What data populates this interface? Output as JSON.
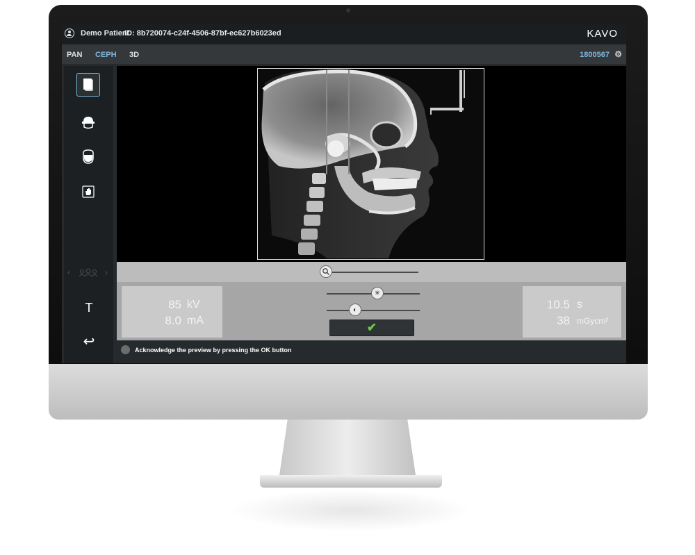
{
  "header": {
    "patient_name": "Demo Patient",
    "patient_id": "ID: 8b720074-c24f-4506-87bf-ec627b6023ed",
    "brand": "KAVO"
  },
  "modes": {
    "tabs": [
      "PAN",
      "CEPH",
      "3D"
    ],
    "active": "CEPH",
    "device_id": "1800567"
  },
  "sidebar": {
    "tools": [
      "ceph-lateral-icon",
      "ceph-head-top-icon",
      "ceph-head-front-icon",
      "hand-icon"
    ],
    "selected_tool": "ceph-lateral-icon",
    "text_tool": "T",
    "back_glyph": "↩"
  },
  "sliders": {
    "zoom_level": 0.0,
    "brightness_level": 0.5,
    "contrast_level": 0.33
  },
  "exposure": {
    "kv_value": "85",
    "kv_unit": "kV",
    "ma_value": "8.0",
    "ma_unit": "mA",
    "time_value": "10.5",
    "time_unit": "s",
    "dose_value": "38",
    "dose_unit": "mGycm²"
  },
  "ok_glyph": "✔",
  "status_message": "Acknowledge the preview by pressing the OK button",
  "colors": {
    "accent": "#7fb8de",
    "ok_green": "#67cc3f",
    "bezel": "#111111"
  }
}
